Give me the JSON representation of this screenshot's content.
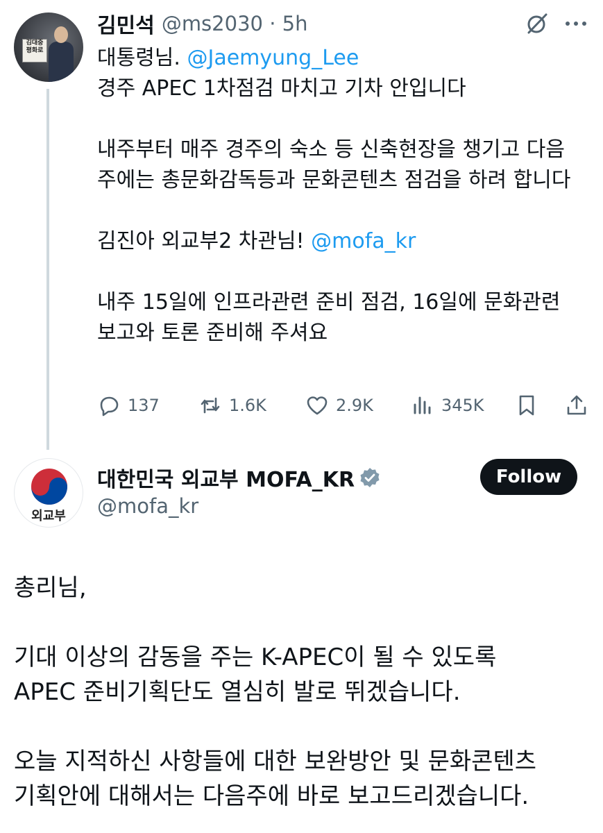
{
  "tweet1": {
    "author_name": "김민석",
    "meta": "@ms2030 · 5h",
    "avatar_sign_lines": [
      "김대중",
      "평화로"
    ],
    "line1_prefix": "대통령님. ",
    "line1_mention": "@Jaemyung_Lee",
    "line2": "경주 APEC 1차점검 마치고 기차 안입니다",
    "para2": "내주부터 매주 경주의 숙소 등 신축현장을 챙기고 다음 주에는 총문화감독등과 문화콘텐츠 점검을 하려 합니다",
    "para3_prefix": "김진아 외교부2 차관님! ",
    "para3_mention": "@mofa_kr",
    "para4": "내주 15일에 인프라관련 준비 점검, 16일에 문화관련 보고와 토론 준비해 주셔요",
    "actions": {
      "replies": "137",
      "reposts": "1.6K",
      "likes": "2.9K",
      "views": "345K"
    }
  },
  "tweet2": {
    "author_name": "대한민국 외교부 MOFA_KR",
    "handle": "@mofa_kr",
    "avatar_label": "외교부",
    "follow_label": "Follow",
    "para1": "총리님,",
    "para2_line1": "기대 이상의 감동을 주는 K-APEC이 될 수 있도록",
    "para2_line2": "APEC 준비기획단도 열심히 발로 뛰겠습니다.",
    "para3_line1": "오늘 지적하신 사항들에 대한 보완방안 및 문화콘텐츠",
    "para3_line2": "기획안에 대해서는 다음주에 바로 보고드리겠습니다."
  },
  "icons": {
    "grok": "grok-icon",
    "more": "more-icon",
    "reply": "reply-icon",
    "repost": "repost-icon",
    "like": "like-icon",
    "views": "views-icon",
    "bookmark": "bookmark-icon",
    "share": "share-icon",
    "verified": "verified-badge-icon"
  },
  "colors": {
    "text": "#0f1419",
    "secondary": "#536471",
    "link": "#1d9bf0",
    "thread_line": "#cfd9de",
    "follow_bg": "#0f1419"
  }
}
